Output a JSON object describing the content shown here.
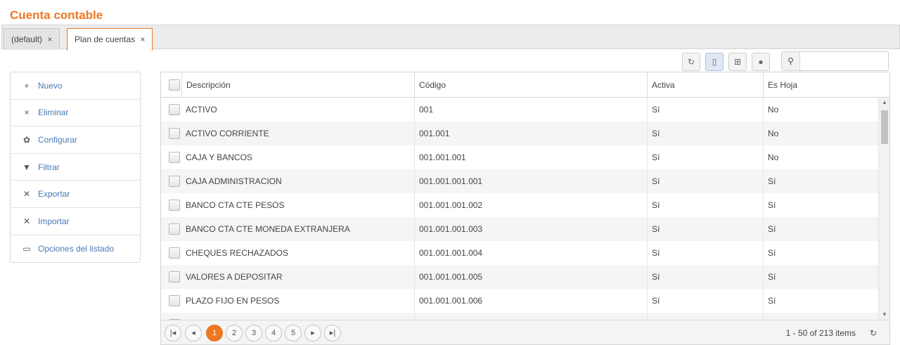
{
  "page_title": "Cuenta contable",
  "tabs": [
    {
      "label": "(default)",
      "close": "×"
    },
    {
      "label": "Plan de cuentas",
      "close": "×"
    }
  ],
  "sidebar": {
    "items": [
      {
        "label": "Nuevo",
        "icon": "+"
      },
      {
        "label": "Eliminar",
        "icon": "×"
      },
      {
        "label": "Configurar",
        "icon": "✿"
      },
      {
        "label": "Filtrar",
        "icon": "▼"
      },
      {
        "label": "Exportar",
        "icon": "✕"
      },
      {
        "label": "Importar",
        "icon": "✕"
      },
      {
        "label": "Opciones del listado",
        "icon": "▭"
      }
    ]
  },
  "toolbar": {
    "refresh_icon": "↻",
    "save_icon": "▯",
    "columns_icon": "⊞",
    "comment_icon": "●",
    "search_icon": "⚲",
    "search_value": ""
  },
  "grid": {
    "headers": [
      "Descripción",
      "Código",
      "Activa",
      "Es Hoja"
    ],
    "rows": [
      [
        "ACTIVO",
        "001",
        "Sí",
        "No"
      ],
      [
        "ACTIVO CORRIENTE",
        "001.001",
        "Sí",
        "No"
      ],
      [
        "CAJA Y BANCOS",
        "001.001.001",
        "Sí",
        "No"
      ],
      [
        "CAJA ADMINISTRACION",
        "001.001.001.001",
        "Sí",
        "Sí"
      ],
      [
        "BANCO CTA CTE PESOS",
        "001.001.001.002",
        "Sí",
        "Sí"
      ],
      [
        "BANCO CTA CTE MONEDA EXTRANJERA",
        "001.001.001.003",
        "Sí",
        "Sí"
      ],
      [
        "CHEQUES RECHAZADOS",
        "001.001.001.004",
        "Sí",
        "Sí"
      ],
      [
        "VALORES A DEPOSITAR",
        "001.001.001.005",
        "Sí",
        "Sí"
      ],
      [
        "PLAZO FIJO EN PESOS",
        "001.001.001.006",
        "Sí",
        "Sí"
      ]
    ]
  },
  "pager": {
    "first": "|◂",
    "prev": "◂",
    "pages": [
      "1",
      "2",
      "3",
      "4",
      "5"
    ],
    "current_page": "1",
    "next": "▸",
    "last": "▸|",
    "info": "1 - 50 of 213 items",
    "refresh_icon": "↻"
  }
}
